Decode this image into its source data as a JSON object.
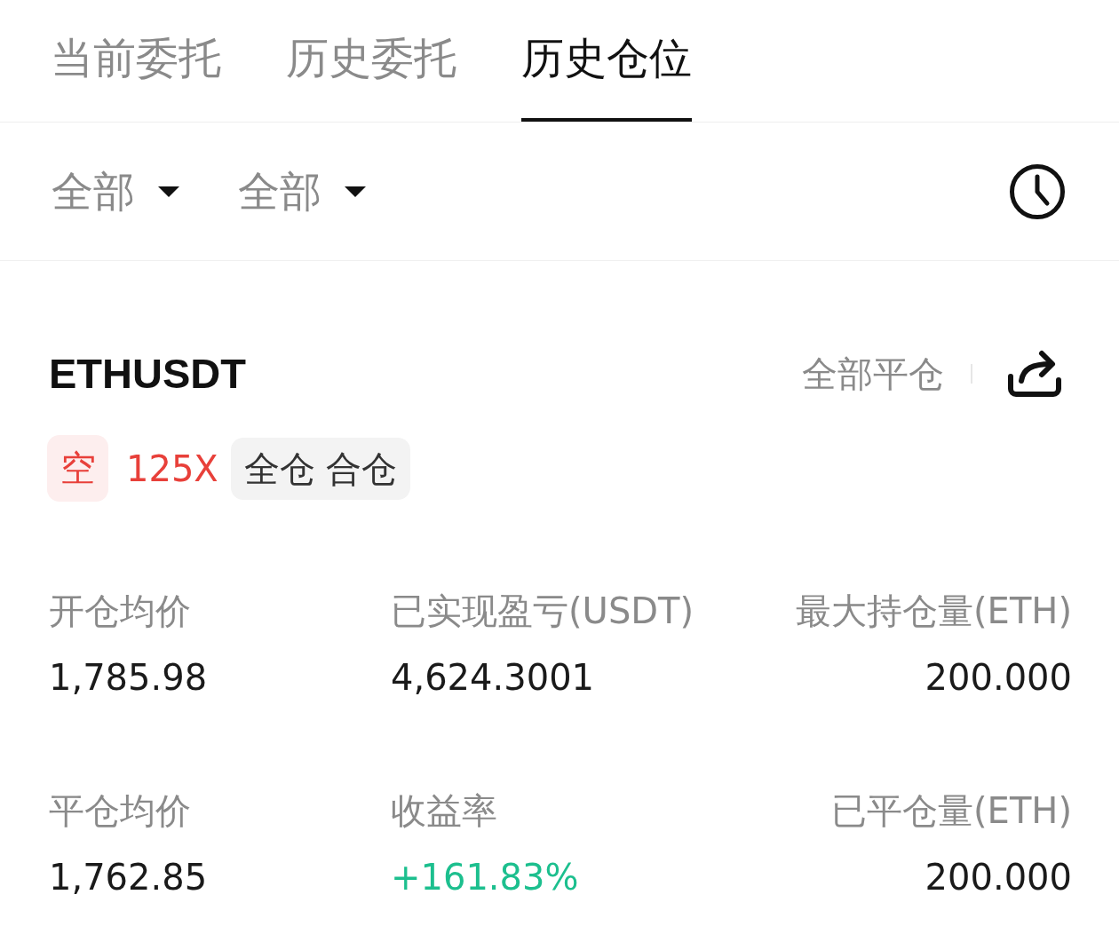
{
  "tabs": [
    {
      "label": "当前委托",
      "selected": false
    },
    {
      "label": "历史委托",
      "selected": false
    },
    {
      "label": "历史仓位",
      "selected": true
    }
  ],
  "filters": [
    {
      "label": "全部"
    },
    {
      "label": "全部"
    }
  ],
  "position": {
    "symbol": "ETHUSDT",
    "close_all": "全部平仓",
    "side": {
      "label": "空",
      "kind": "short"
    },
    "leverage": "125X",
    "margin_mode": "全仓 合仓",
    "fields": [
      {
        "label": "开仓均价",
        "value": "1,785.98",
        "kind": "plain"
      },
      {
        "label": "已实现盈亏(USDT)",
        "value": "4,624.3001",
        "kind": "plain"
      },
      {
        "label": "最大持仓量(ETH)",
        "value": "200.000",
        "kind": "plain"
      },
      {
        "label": "平仓均价",
        "value": "1,762.85",
        "kind": "plain"
      },
      {
        "label": "收益率",
        "value": "+161.83%",
        "kind": "gain"
      },
      {
        "label": "已平仓量(ETH)",
        "value": "200.000",
        "kind": "plain"
      }
    ]
  }
}
